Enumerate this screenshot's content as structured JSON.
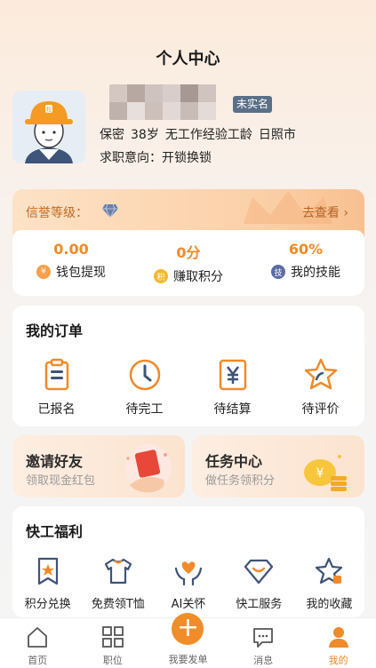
{
  "header": {
    "title": "个人中心"
  },
  "profile": {
    "badge": "未实名",
    "gender": "保密",
    "age": "38岁",
    "experience": "无工作经验工龄",
    "city": "日照市",
    "intent": "求职意向：开锁换锁"
  },
  "credit": {
    "label": "信誉等级：",
    "link": "去查看",
    "stats": [
      {
        "value": "0.00",
        "label": "钱包提现",
        "icon": "wallet-icon",
        "icon_char": "¥",
        "color": "#f5a04c"
      },
      {
        "value": "0分",
        "label": "赚取积分",
        "icon": "points-icon",
        "icon_char": "积",
        "color": "#f7b733"
      },
      {
        "value": "60%",
        "label": "我的技能",
        "icon": "skill-icon",
        "icon_char": "技",
        "color": "#5b6aa8"
      }
    ]
  },
  "orders": {
    "title": "我的订单",
    "items": [
      {
        "label": "已报名",
        "icon": "clipboard-icon"
      },
      {
        "label": "待完工",
        "icon": "clock-icon"
      },
      {
        "label": "待结算",
        "icon": "yen-icon"
      },
      {
        "label": "待评价",
        "icon": "star-icon"
      }
    ]
  },
  "promos": {
    "invite": {
      "title": "邀请好友",
      "sub": "领取现金红包"
    },
    "tasks": {
      "title": "任务中心",
      "sub": "做任务领积分"
    }
  },
  "welfare": {
    "title": "快工福利",
    "items": [
      {
        "label": "积分兑换",
        "icon": "badge-star-icon"
      },
      {
        "label": "免费领T恤",
        "icon": "tshirt-icon"
      },
      {
        "label": "AI关怀",
        "icon": "care-heart-icon"
      },
      {
        "label": "快工服务",
        "icon": "service-icon"
      },
      {
        "label": "我的收藏",
        "icon": "favorite-icon"
      }
    ]
  },
  "tabbar": {
    "items": [
      {
        "label": "首页",
        "icon": "home-icon"
      },
      {
        "label": "职位",
        "icon": "grid-icon"
      },
      {
        "label": "我要发单",
        "icon": "plus-icon"
      },
      {
        "label": "消息",
        "icon": "message-icon"
      },
      {
        "label": "我的",
        "icon": "person-icon"
      }
    ],
    "active_color": "#f08a2a"
  },
  "colors": {
    "accent": "#f08a2a",
    "badge": "#5a6f88"
  }
}
